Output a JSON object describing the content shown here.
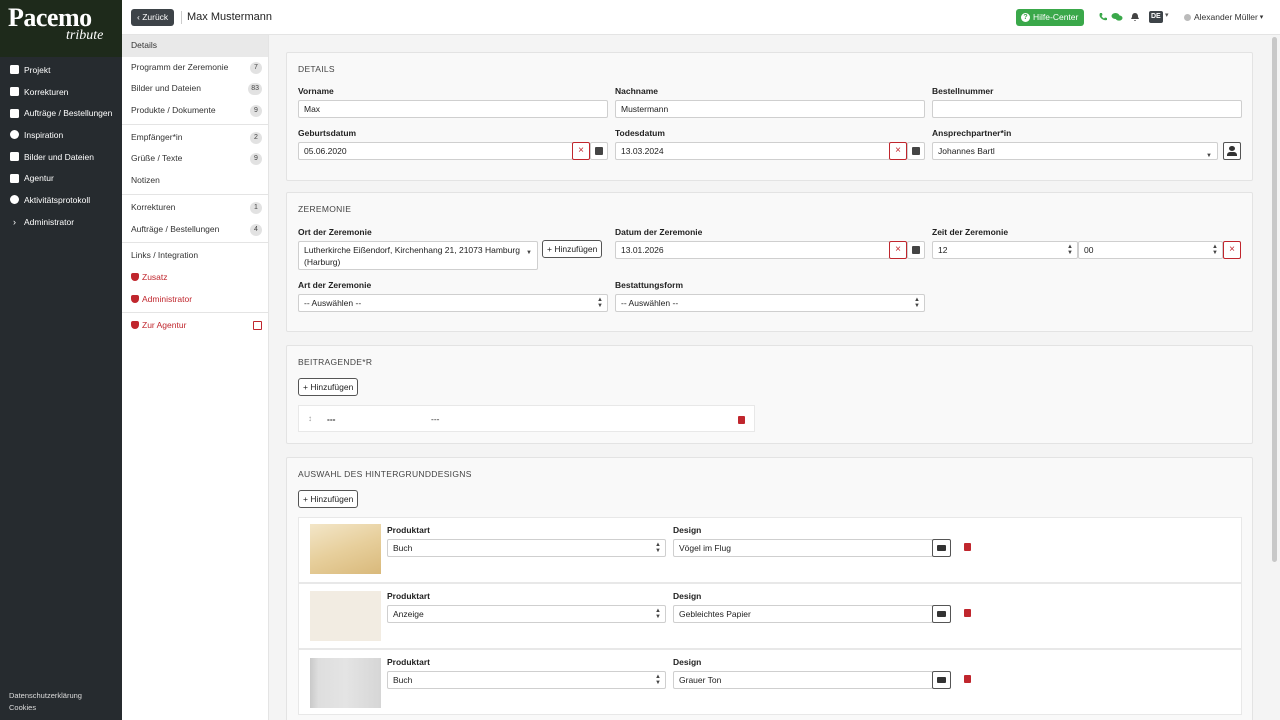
{
  "logo": {
    "main": "Pacemo",
    "sub": "tribute"
  },
  "sidebar": {
    "items": [
      {
        "label": "Projekt",
        "icon": "user-icon"
      },
      {
        "label": "Korrekturen",
        "icon": "pencil-icon"
      },
      {
        "label": "Aufträge / Bestellungen",
        "icon": "cart-icon"
      },
      {
        "label": "Inspiration",
        "icon": "lightbulb-icon"
      },
      {
        "label": "Bilder und Dateien",
        "icon": "folder-icon"
      },
      {
        "label": "Agentur",
        "icon": "building-icon"
      },
      {
        "label": "Aktivitätsprotokoll",
        "icon": "activity-icon"
      },
      {
        "label": "Administrator",
        "icon": "chevron-right-icon"
      }
    ],
    "footer": {
      "privacy": "Datenschutzerklärung",
      "cookies": "Cookies"
    }
  },
  "topbar": {
    "back_label": "Zurück",
    "title": "Max Mustermann",
    "help_label": "Hilfe-Center",
    "language": "DE",
    "user_name": "Alexander Müller"
  },
  "subnav": {
    "details": "Details",
    "programm": {
      "label": "Programm der Zeremonie",
      "count": "7"
    },
    "bilder": {
      "label": "Bilder und Dateien",
      "count": "83"
    },
    "produkte": {
      "label": "Produkte / Dokumente",
      "count": "9"
    },
    "empfaenger": {
      "label": "Empfänger*in",
      "count": "2"
    },
    "gruesse": {
      "label": "Grüße / Texte",
      "count": "9"
    },
    "notizen": "Notizen",
    "korrekturen": {
      "label": "Korrekturen",
      "count": "1"
    },
    "auftraege": {
      "label": "Aufträge / Bestellungen",
      "count": "4"
    },
    "links": "Links / Integration",
    "zusatz": "Zusatz",
    "administrator": "Administrator",
    "agentur": "Zur Agentur"
  },
  "details": {
    "title": "DETAILS",
    "vorname_label": "Vorname",
    "vorname": "Max",
    "nachname_label": "Nachname",
    "nachname": "Mustermann",
    "bestell_label": "Bestellnummer",
    "bestell": "",
    "geburt_label": "Geburtsdatum",
    "geburt": "05.06.2020",
    "tod_label": "Todesdatum",
    "tod": "13.03.2024",
    "ansprech_label": "Ansprechpartner*in",
    "ansprech": "Johannes Bartl"
  },
  "zeremonie": {
    "title": "ZEREMONIE",
    "ort_label": "Ort der Zeremonie",
    "ort": "Lutherkirche Eißendorf, Kirchenhang 21, 21073 Hamburg (Harburg)",
    "add_label": "Hinzufügen",
    "datum_label": "Datum der Zeremonie",
    "datum": "13.01.2026",
    "zeit_label": "Zeit der Zeremonie",
    "stunde": "12",
    "minute": "00",
    "art_label": "Art der Zeremonie",
    "art": "-- Auswählen --",
    "bestattung_label": "Bestattungsform",
    "bestattung": "-- Auswählen --"
  },
  "beitragende": {
    "title": "BEITRAGENDE*R",
    "add_label": "Hinzufügen",
    "row": {
      "name": "---",
      "role": "---"
    }
  },
  "hintergrund": {
    "title": "AUSWAHL DES HINTERGRUNDDESIGNS",
    "add_label": "Hinzufügen",
    "produktart_label": "Produktart",
    "design_label": "Design",
    "rows": [
      {
        "produktart": "Buch",
        "design": "Vögel im Flug"
      },
      {
        "produktart": "Anzeige",
        "design": "Gebleichtes Papier"
      },
      {
        "produktart": "Buch",
        "design": "Grauer Ton"
      }
    ]
  },
  "colors": {
    "accent_green": "#3aa84a",
    "danger": "#c0262d",
    "sidebar": "#262b2f"
  }
}
